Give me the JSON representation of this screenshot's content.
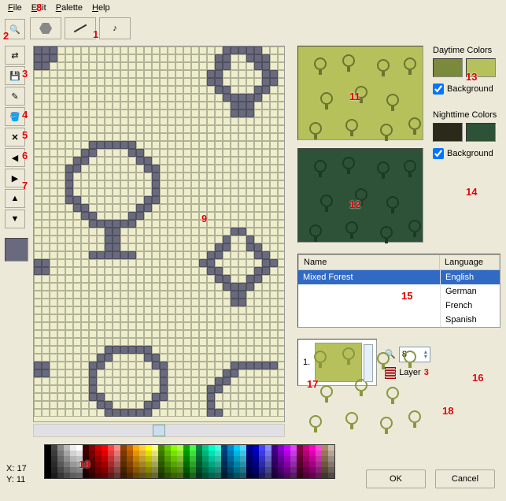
{
  "menu": {
    "file": "File",
    "edit": "Edit",
    "palette": "Palette",
    "help": "Help"
  },
  "tools": {
    "zoom": "zoom",
    "shape": "shape",
    "line": "line",
    "note": "note",
    "arrow_lr": "swap-horiz",
    "save": "save",
    "pencil": "pencil",
    "fill": "fill",
    "clear": "clear",
    "left": "left",
    "right": "right",
    "up": "up",
    "down": "down"
  },
  "colors": {
    "day_title": "Daytime Colors",
    "night_title": "Nighttime Colors",
    "bg_label": "Background",
    "day": [
      "#7a8a3a",
      "#b6c15b"
    ],
    "night": [
      "#2a2a1a",
      "#2e5237"
    ]
  },
  "table": {
    "hdr_name": "Name",
    "hdr_lang": "Language",
    "rows": [
      {
        "name": "Mixed Forest",
        "lang": "English"
      },
      {
        "name": "",
        "lang": "German"
      },
      {
        "name": "",
        "lang": "French"
      },
      {
        "name": "",
        "lang": "Spanish"
      }
    ]
  },
  "layer": {
    "prefix": "1.",
    "label": "Layer",
    "count": "3"
  },
  "zoom": {
    "value": "8"
  },
  "status": {
    "x_label": "X:",
    "x": "17",
    "y_label": "Y:",
    "y": "11"
  },
  "buttons": {
    "ok": "OK",
    "cancel": "Cancel"
  },
  "annotations": {
    "1": "1",
    "2": "2",
    "3": "3",
    "4": "4",
    "5": "5",
    "6": "6",
    "7": "7",
    "8": "8",
    "9": "9",
    "10": "10",
    "11": "11",
    "12": "12",
    "13": "13",
    "14": "14",
    "15": "15",
    "16": "16",
    "17": "17",
    "18": "18"
  }
}
